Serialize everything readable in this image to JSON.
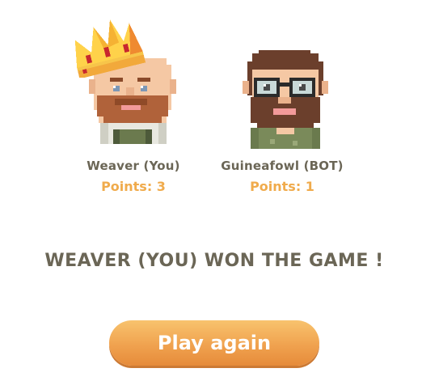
{
  "players": [
    {
      "name": "Weaver (You)",
      "points": "Points: 3",
      "avatar": "bald-bearded-man-avatar",
      "crown": "crown-icon"
    },
    {
      "name": "Guineafowl (BOT)",
      "points": "Points: 1",
      "avatar": "glasses-bearded-man-avatar"
    }
  ],
  "result_text": "WEAVER (YOU) WON THE GAME !",
  "play_again_label": "Play again",
  "colors": {
    "text_dark": "#6b6656",
    "points_orange": "#f0ab4c",
    "button_top": "#f8c36e",
    "button_bottom": "#e68b3a"
  }
}
